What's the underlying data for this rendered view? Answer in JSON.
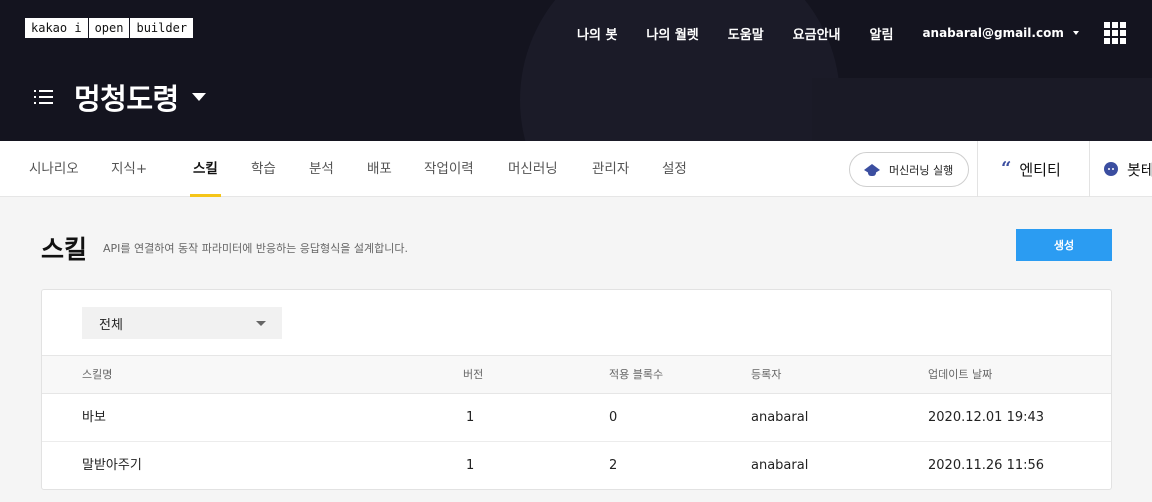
{
  "logo": {
    "parts": [
      "kakao i",
      "open",
      "builder"
    ]
  },
  "topnav": {
    "links": [
      "나의 봇",
      "나의 월렛",
      "도움말",
      "요금안내",
      "알림"
    ],
    "user_email": "anabaral@gmail.com"
  },
  "bot": {
    "name": "멍청도령"
  },
  "tabs": [
    "시나리오",
    "지식+",
    "스킬",
    "학습",
    "분석",
    "배포",
    "작업이력",
    "머신러닝",
    "관리자",
    "설정"
  ],
  "active_tab": "스킬",
  "tab_actions": {
    "ml_run": "머신러닝 실행",
    "entity": "엔티티",
    "bot_test": "봇테"
  },
  "page": {
    "title": "스킬",
    "description": "API를 연결하여 동작 파라미터에 반응하는 응답형식을 설계합니다.",
    "create_label": "생성"
  },
  "filter": {
    "selected": "전체"
  },
  "table": {
    "columns": [
      "스킬명",
      "버전",
      "적용 블록수",
      "등록자",
      "업데이트 날짜"
    ],
    "rows": [
      [
        "바보",
        "1",
        "0",
        "anabaral",
        "2020.12.01 19:43"
      ],
      [
        "말받아주기",
        "1",
        "2",
        "anabaral",
        "2020.11.26 11:56"
      ]
    ]
  },
  "colors": {
    "header_bg": "#14141f",
    "accent_yellow": "#f5c518",
    "primary_blue": "#2b9cf2",
    "icon_blue": "#3b4ea0"
  }
}
